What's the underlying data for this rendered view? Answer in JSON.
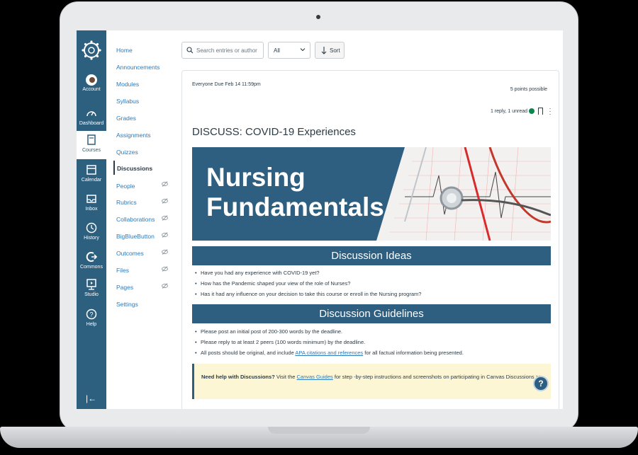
{
  "global_nav": {
    "items": [
      {
        "label": "Account",
        "icon": "avatar"
      },
      {
        "label": "Dashboard",
        "icon": "dashboard-icon"
      },
      {
        "label": "Courses",
        "icon": "courses-icon"
      },
      {
        "label": "Calendar",
        "icon": "calendar-icon"
      },
      {
        "label": "Inbox",
        "icon": "inbox-icon"
      },
      {
        "label": "History",
        "icon": "history-icon"
      },
      {
        "label": "Commons",
        "icon": "commons-icon"
      },
      {
        "label": "Studio",
        "icon": "studio-icon"
      },
      {
        "label": "Help",
        "icon": "help-icon"
      }
    ],
    "active": "Courses",
    "collapse_glyph": "|←"
  },
  "course_nav": {
    "items": [
      {
        "label": "Home"
      },
      {
        "label": "Announcements"
      },
      {
        "label": "Modules"
      },
      {
        "label": "Syllabus"
      },
      {
        "label": "Grades"
      },
      {
        "label": "Assignments"
      },
      {
        "label": "Quizzes"
      },
      {
        "label": "Discussions"
      },
      {
        "label": "People"
      },
      {
        "label": "Rubrics"
      },
      {
        "label": "Collaborations"
      },
      {
        "label": "BigBlueButton"
      },
      {
        "label": "Outcomes"
      },
      {
        "label": "Files"
      },
      {
        "label": "Pages"
      },
      {
        "label": "Settings"
      }
    ],
    "active": "Discussions"
  },
  "toolbar": {
    "search_placeholder": "Search entries or author",
    "filter_value": "All",
    "sort_label": "Sort"
  },
  "post": {
    "meta": "Everyone   Due Feb 14 11:59pm",
    "points": "5 points possible",
    "reply_status": "1 reply, 1 unread",
    "title": "DISCUSS: COVID-19 Experiences",
    "banner_title_line1": "Nursing",
    "banner_title_line2": "Fundamentals",
    "ideas_heading": "Discussion Ideas",
    "ideas": [
      "Have you had any experience with COVID-19 yet?",
      "How has the Pandemic shaped your view of the role of Nurses?",
      "Has it had any influence on your decision to take this course or enroll in the Nursing program?"
    ],
    "guidelines_heading": "Discussion Guidelines",
    "guidelines": [
      "Please post an initial post of 200-300 words by the deadline.",
      "Please reply to at least 2 peers (100 words minimum) by the deadline."
    ],
    "guideline3_before": "All posts should be original, and include ",
    "guideline3_link": "APA citations and references",
    "guideline3_after": " for all factual information being presented.",
    "help_bold": "Need help with Discussions?",
    "help_before": " Visit the ",
    "help_link": "Canvas Guides",
    "help_after": " for step -by-step instructions and screenshots on participating in Canvas Discussions >>",
    "help_fab": "?"
  },
  "colors": {
    "canvas_nav": "#2d5f7f",
    "link": "#2b7abc",
    "banner": "#2e5f80",
    "callout": "#fdf6d5"
  }
}
